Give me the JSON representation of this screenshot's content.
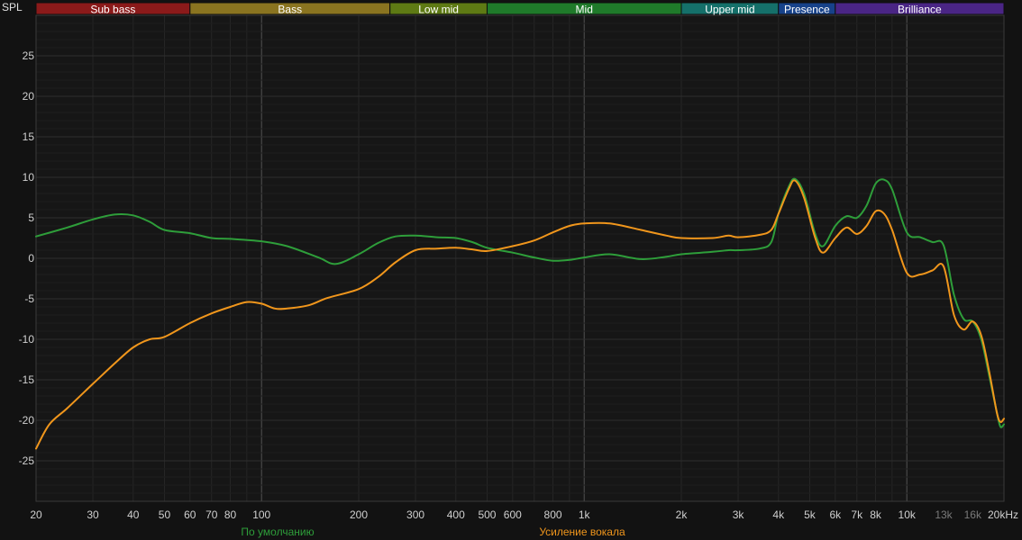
{
  "chart_data": {
    "type": "line",
    "ylabel": "SPL",
    "xscale": "log",
    "xlim": [
      20,
      20000
    ],
    "ylim": [
      -30,
      30
    ],
    "grid": true,
    "legend_position": "bottom-center",
    "bands": [
      {
        "label": "Sub bass",
        "range": [
          20,
          60
        ],
        "color": "#8b1a1a"
      },
      {
        "label": "Bass",
        "range": [
          60,
          250
        ],
        "color": "#8a7420"
      },
      {
        "label": "Low mid",
        "range": [
          250,
          500
        ],
        "color": "#5e7a14"
      },
      {
        "label": "Mid",
        "range": [
          500,
          2000
        ],
        "color": "#1f7a2a"
      },
      {
        "label": "Upper mid",
        "range": [
          2000,
          4000
        ],
        "color": "#15706a"
      },
      {
        "label": "Presence",
        "range": [
          4000,
          6000
        ],
        "color": "#17428a"
      },
      {
        "label": "Brilliance",
        "range": [
          6000,
          20000
        ],
        "color": "#4a2585"
      }
    ],
    "y_ticks": [
      25,
      20,
      15,
      10,
      5,
      0,
      -5,
      -10,
      -15,
      -20,
      -25
    ],
    "x_ticks": [
      {
        "value": 20,
        "label": "20"
      },
      {
        "value": 30,
        "label": "30"
      },
      {
        "value": 40,
        "label": "40"
      },
      {
        "value": 50,
        "label": "50"
      },
      {
        "value": 60,
        "label": "60"
      },
      {
        "value": 70,
        "label": "70"
      },
      {
        "value": 80,
        "label": "80"
      },
      {
        "value": 100,
        "label": "100"
      },
      {
        "value": 200,
        "label": "200"
      },
      {
        "value": 300,
        "label": "300"
      },
      {
        "value": 400,
        "label": "400"
      },
      {
        "value": 500,
        "label": "500"
      },
      {
        "value": 600,
        "label": "600"
      },
      {
        "value": 800,
        "label": "800"
      },
      {
        "value": 1000,
        "label": "1k"
      },
      {
        "value": 2000,
        "label": "2k"
      },
      {
        "value": 3000,
        "label": "3k"
      },
      {
        "value": 4000,
        "label": "4k"
      },
      {
        "value": 5000,
        "label": "5k"
      },
      {
        "value": 6000,
        "label": "6k"
      },
      {
        "value": 7000,
        "label": "7k"
      },
      {
        "value": 8000,
        "label": "8k"
      },
      {
        "value": 10000,
        "label": "10k"
      },
      {
        "value": 13000,
        "label": "13k",
        "dim": true
      },
      {
        "value": 16000,
        "label": "16k",
        "dim": true
      },
      {
        "value": 20000,
        "label": "20kHz"
      }
    ],
    "series": [
      {
        "name": "По умолчанию",
        "color": "#2e9e3a",
        "points": [
          [
            20,
            2.7
          ],
          [
            25,
            3.8
          ],
          [
            30,
            4.8
          ],
          [
            35,
            5.4
          ],
          [
            40,
            5.3
          ],
          [
            45,
            4.5
          ],
          [
            50,
            3.5
          ],
          [
            60,
            3.1
          ],
          [
            70,
            2.5
          ],
          [
            80,
            2.4
          ],
          [
            100,
            2.1
          ],
          [
            120,
            1.5
          ],
          [
            150,
            0.1
          ],
          [
            170,
            -0.7
          ],
          [
            200,
            0.5
          ],
          [
            230,
            1.9
          ],
          [
            260,
            2.7
          ],
          [
            300,
            2.8
          ],
          [
            350,
            2.6
          ],
          [
            400,
            2.5
          ],
          [
            450,
            2.0
          ],
          [
            500,
            1.3
          ],
          [
            600,
            0.7
          ],
          [
            700,
            0.1
          ],
          [
            800,
            -0.3
          ],
          [
            900,
            -0.2
          ],
          [
            1000,
            0.1
          ],
          [
            1200,
            0.5
          ],
          [
            1500,
            -0.1
          ],
          [
            1800,
            0.2
          ],
          [
            2000,
            0.5
          ],
          [
            2500,
            0.8
          ],
          [
            2800,
            1.0
          ],
          [
            3000,
            1.0
          ],
          [
            3500,
            1.2
          ],
          [
            3800,
            2.0
          ],
          [
            4000,
            5.5
          ],
          [
            4300,
            8.8
          ],
          [
            4500,
            9.8
          ],
          [
            4800,
            8.0
          ],
          [
            5200,
            3.0
          ],
          [
            5500,
            1.5
          ],
          [
            6000,
            4.0
          ],
          [
            6500,
            5.2
          ],
          [
            7000,
            5.0
          ],
          [
            7500,
            6.5
          ],
          [
            8000,
            9.2
          ],
          [
            8500,
            9.7
          ],
          [
            9000,
            8.5
          ],
          [
            10000,
            3.2
          ],
          [
            11000,
            2.6
          ],
          [
            12000,
            2.0
          ],
          [
            13000,
            1.6
          ],
          [
            14000,
            -4.5
          ],
          [
            15000,
            -7.5
          ],
          [
            16000,
            -7.8
          ],
          [
            17000,
            -10.0
          ],
          [
            18000,
            -14.5
          ],
          [
            19000,
            -19.0
          ],
          [
            19500,
            -20.8
          ],
          [
            20000,
            -20.5
          ]
        ]
      },
      {
        "name": "Усиление вокала",
        "color": "#f0961c",
        "points": [
          [
            20,
            -23.5
          ],
          [
            22,
            -20.5
          ],
          [
            25,
            -18.5
          ],
          [
            30,
            -15.5
          ],
          [
            35,
            -13.0
          ],
          [
            40,
            -11.0
          ],
          [
            45,
            -10.0
          ],
          [
            50,
            -9.7
          ],
          [
            60,
            -8.0
          ],
          [
            70,
            -6.8
          ],
          [
            80,
            -6.0
          ],
          [
            90,
            -5.4
          ],
          [
            100,
            -5.6
          ],
          [
            110,
            -6.2
          ],
          [
            120,
            -6.2
          ],
          [
            140,
            -5.8
          ],
          [
            160,
            -4.9
          ],
          [
            200,
            -3.8
          ],
          [
            230,
            -2.3
          ],
          [
            260,
            -0.5
          ],
          [
            300,
            1.0
          ],
          [
            350,
            1.2
          ],
          [
            400,
            1.3
          ],
          [
            450,
            1.1
          ],
          [
            500,
            0.9
          ],
          [
            600,
            1.5
          ],
          [
            700,
            2.2
          ],
          [
            800,
            3.2
          ],
          [
            900,
            4.0
          ],
          [
            1000,
            4.3
          ],
          [
            1200,
            4.3
          ],
          [
            1500,
            3.5
          ],
          [
            1800,
            2.8
          ],
          [
            2000,
            2.5
          ],
          [
            2500,
            2.5
          ],
          [
            2800,
            2.8
          ],
          [
            3000,
            2.6
          ],
          [
            3500,
            2.9
          ],
          [
            3800,
            3.5
          ],
          [
            4000,
            5.5
          ],
          [
            4300,
            8.5
          ],
          [
            4500,
            9.6
          ],
          [
            4800,
            7.5
          ],
          [
            5200,
            2.5
          ],
          [
            5500,
            0.7
          ],
          [
            6000,
            2.5
          ],
          [
            6500,
            3.8
          ],
          [
            7000,
            3.0
          ],
          [
            7500,
            4.0
          ],
          [
            8000,
            5.8
          ],
          [
            8500,
            5.5
          ],
          [
            9000,
            3.5
          ],
          [
            10000,
            -1.8
          ],
          [
            11000,
            -2.0
          ],
          [
            12000,
            -1.5
          ],
          [
            13000,
            -1.0
          ],
          [
            14000,
            -7.0
          ],
          [
            15000,
            -8.8
          ],
          [
            16000,
            -7.8
          ],
          [
            17000,
            -9.5
          ],
          [
            18000,
            -14.0
          ],
          [
            19000,
            -19.0
          ],
          [
            19500,
            -20.2
          ],
          [
            20000,
            -19.8
          ]
        ]
      }
    ]
  }
}
